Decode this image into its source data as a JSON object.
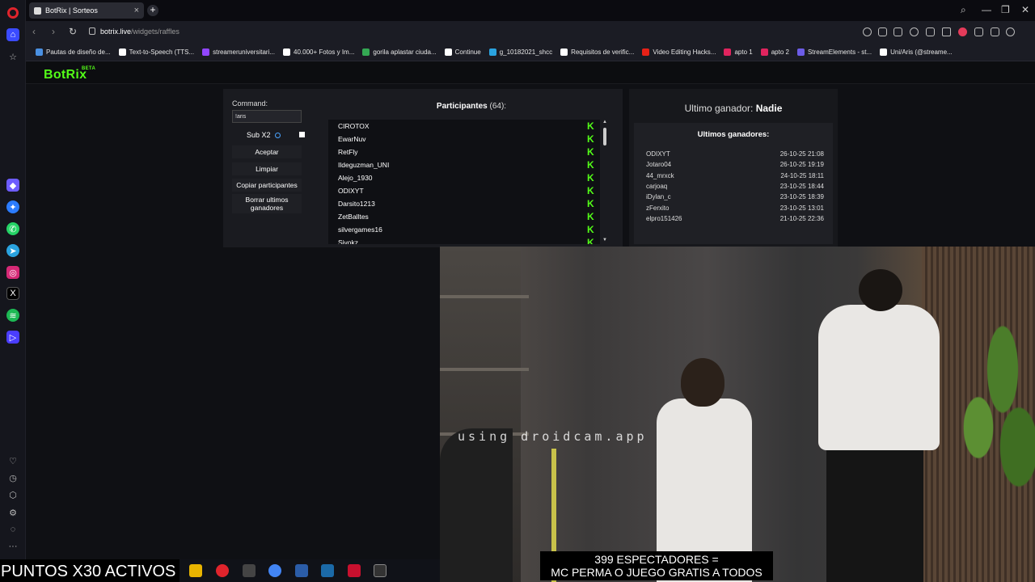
{
  "browser": {
    "tab_title": "BotRix | Sorteos",
    "url_host": "botrix.live",
    "url_path": "/widgets/raffles",
    "bookmarks": [
      "Pautas de diseño de...",
      "Text-to-Speech (TTS...",
      "streameruniversitari...",
      "40.000+ Fotos y Im...",
      "gorila aplastar ciuda...",
      "Continue",
      "g_10182021_shcc",
      "Requisitos de verific...",
      "Video Editing Hacks...",
      "apto 1",
      "apto 2",
      "StreamElements - st...",
      "Uni/Aris (@streame..."
    ]
  },
  "app": {
    "logo": "BotRix",
    "logo_badge": "BETA"
  },
  "controls": {
    "command_label": "Command:",
    "command_value": "!aris",
    "sub_label": "Sub X2",
    "accept": "Aceptar",
    "clear": "Limpiar",
    "copy": "Copiar participantes",
    "delete_winners": "Borrar ultimos ganadores"
  },
  "participants": {
    "title": "Participantes",
    "count": "(64):",
    "items": [
      "CIROTOX",
      "EwarNuv",
      "RetFly",
      "Ildeguzman_UNI",
      "Alejo_1930",
      "ODIXYT",
      "Darsito1213",
      "ZetBalltes",
      "silvergames16",
      "Sivokz"
    ],
    "badge_color": "#53fc18"
  },
  "winner": {
    "label": "Ultimo ganador:",
    "name": "Nadie",
    "recent_title": "Ultimos ganadores:",
    "recent": [
      {
        "name": "ODIXYT",
        "date": "26-10-25 21:08"
      },
      {
        "name": "Jotaro04",
        "date": "26-10-25 19:19"
      },
      {
        "name": "44_mrxck",
        "date": "24-10-25 18:11"
      },
      {
        "name": "carjoaq",
        "date": "23-10-25 18:44"
      },
      {
        "name": "iDylan_c",
        "date": "23-10-25 18:39"
      },
      {
        "name": "zFerxito",
        "date": "23-10-25 13:01"
      },
      {
        "name": "elpro151426",
        "date": "21-10-25 22:36"
      }
    ]
  },
  "stream": {
    "watermark": "using droidcam.app",
    "subtitle_line1": "399 ESPECTADORES =",
    "subtitle_line2": "MC PERMA O JUEGO GRATIS A TODOS",
    "ticker": "PUNTOS X30 ACTIVOS"
  }
}
